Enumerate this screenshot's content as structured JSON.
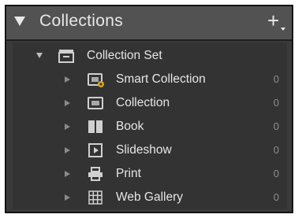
{
  "panel": {
    "title": "Collections",
    "add_button_icon": "plus-icon"
  },
  "collection_set": {
    "label": "Collection Set",
    "icon": "collection-set-icon",
    "expanded": true
  },
  "items": [
    {
      "label": "Smart Collection",
      "count": "0",
      "icon": "smart-collection-icon"
    },
    {
      "label": "Collection",
      "count": "0",
      "icon": "collection-icon"
    },
    {
      "label": "Book",
      "count": "0",
      "icon": "book-icon"
    },
    {
      "label": "Slideshow",
      "count": "0",
      "icon": "slideshow-icon"
    },
    {
      "label": "Print",
      "count": "0",
      "icon": "print-icon"
    },
    {
      "label": "Web Gallery",
      "count": "0",
      "icon": "web-gallery-icon"
    }
  ],
  "colors": {
    "panel_bg": "#3a3a3a",
    "header_bg": "#525252",
    "list_bg": "#333333",
    "text": "#e6e6e6",
    "count_text": "#8e8e8e",
    "smart_badge": "#d9a520"
  }
}
